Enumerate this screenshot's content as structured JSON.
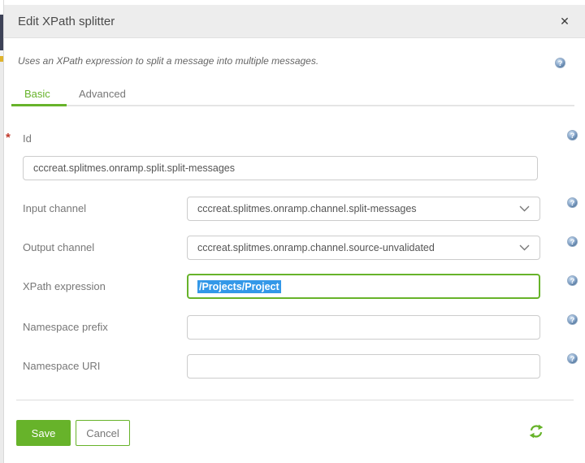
{
  "theme": {
    "green": "#67b32a",
    "selection": "#3398e8",
    "help-fill": "#55799f"
  },
  "dialog": {
    "title": "Edit XPath splitter",
    "description": "Uses an XPath expression to split a message into multiple messages.",
    "icons": {
      "close": "✕",
      "help": "?"
    },
    "required_marker": "*",
    "tabs": {
      "basic": "Basic",
      "advanced": "Advanced"
    },
    "fields": {
      "id": {
        "label": "Id",
        "value": "cccreat.splitmes.onramp.split.split-messages"
      },
      "input_channel": {
        "label": "Input channel",
        "value": "cccreat.splitmes.onramp.channel.split-messages"
      },
      "output_channel": {
        "label": "Output channel",
        "value": "cccreat.splitmes.onramp.channel.source-unvalidated"
      },
      "xpath_expression": {
        "label": "XPath expression",
        "value": "/Projects/Project"
      },
      "namespace_prefix": {
        "label": "Namespace prefix",
        "value": ""
      },
      "namespace_uri": {
        "label": "Namespace URI",
        "value": ""
      }
    },
    "buttons": {
      "save": "Save",
      "cancel": "Cancel"
    }
  }
}
